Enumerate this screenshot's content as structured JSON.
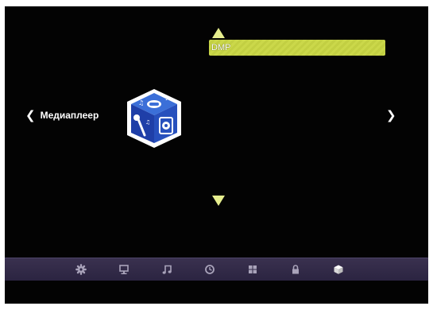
{
  "menu": {
    "category_label": "Медиаплеер",
    "selected_item": "DMP"
  },
  "bottom_bar": {
    "icons": [
      "settings-gear-icon",
      "monitor-icon",
      "music-note-icon",
      "clock-icon",
      "apps-grid-icon",
      "lock-icon",
      "cube-icon"
    ],
    "active": "cube-icon"
  },
  "colors": {
    "background": "#030303",
    "highlight": "#cbd84a",
    "arrow": "#e6ee8e",
    "bar": "#2b2441",
    "icon": "#a9a3ba",
    "icon_active": "#ffffff"
  }
}
